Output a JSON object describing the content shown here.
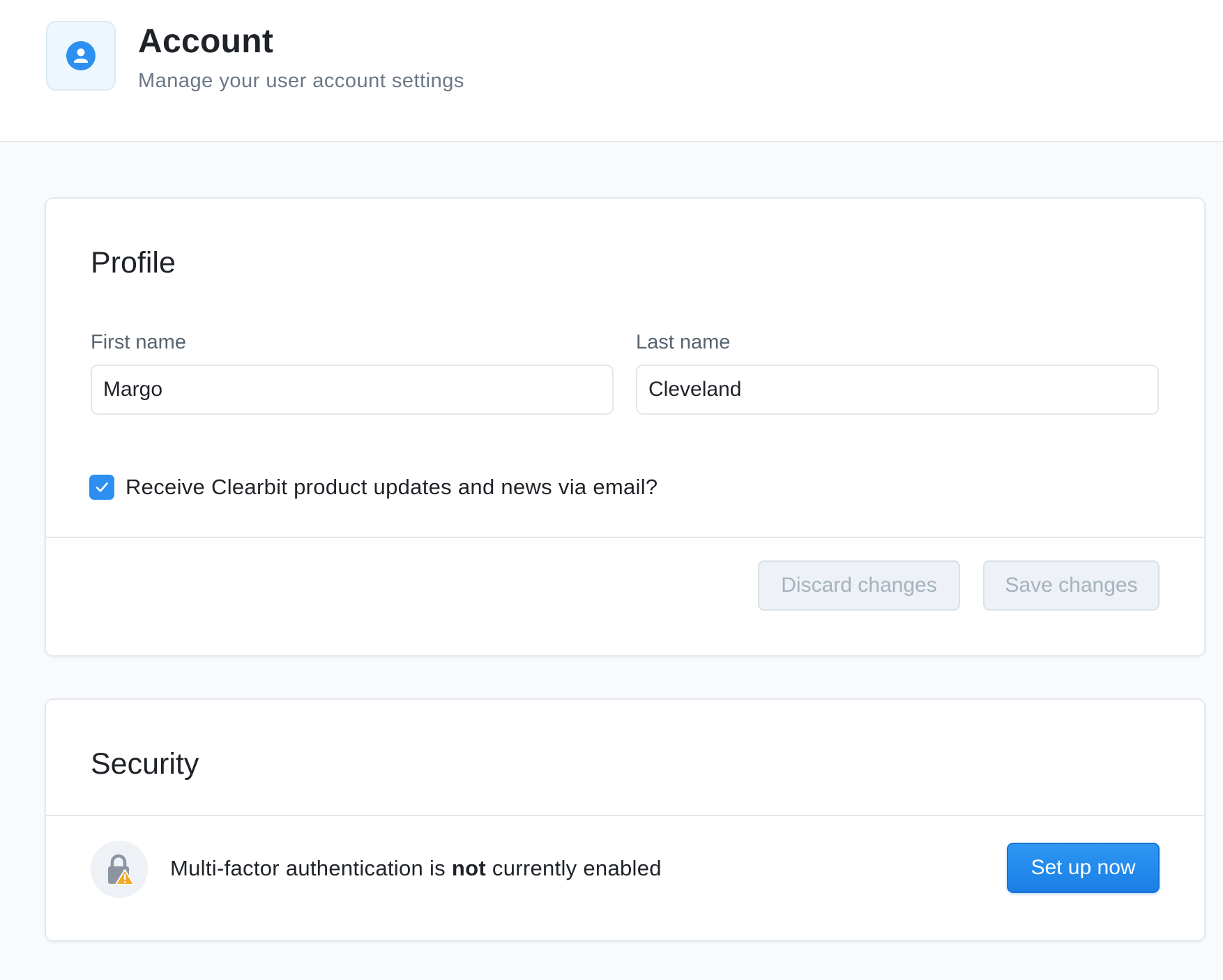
{
  "header": {
    "icon": "user-icon",
    "title": "Account",
    "subtitle": "Manage your user account settings"
  },
  "profile": {
    "title": "Profile",
    "first_name_label": "First name",
    "first_name_value": "Margo",
    "last_name_label": "Last name",
    "last_name_value": "Cleveland",
    "newsletter_label": "Receive Clearbit product updates and news via email?",
    "newsletter_checked": true,
    "discard_label": "Discard changes",
    "save_label": "Save changes"
  },
  "security": {
    "title": "Security",
    "icon": "lock-warning-icon",
    "mfa_prefix": "Multi-factor authentication is ",
    "mfa_emphasis": "not",
    "mfa_suffix": " currently enabled",
    "setup_label": "Set up now"
  },
  "colors": {
    "accent": "#2d8ff0",
    "warning": "#f5a623",
    "background": "#f8fafc"
  }
}
